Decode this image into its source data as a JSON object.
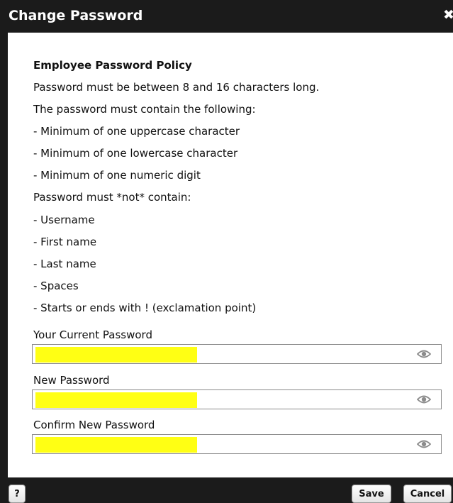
{
  "dialog": {
    "title": "Change Password",
    "close_icon_glyph": "✖"
  },
  "policy": {
    "heading": "Employee Password Policy",
    "lines": [
      "Password must be between 8 and 16 characters long.",
      "The password must contain the following:",
      "- Minimum of one uppercase character",
      "- Minimum of one lowercase character",
      "- Minimum of one numeric digit",
      "Password must *not* contain:",
      "- Username",
      "- First name",
      "- Last name",
      "- Spaces",
      "- Starts or ends with ! (exclamation point)"
    ]
  },
  "fields": {
    "current": {
      "label": "Your Current Password",
      "icon": "eye-icon"
    },
    "new": {
      "label": "New Password",
      "icon": "eye-icon"
    },
    "confirm": {
      "label": "Confirm New Password",
      "icon": "eye-icon"
    }
  },
  "footer": {
    "help_label": "?",
    "save_label": "Save",
    "cancel_label": "Cancel"
  },
  "colors": {
    "titlebar": "#1b1b1b",
    "redaction": "#ffff14",
    "eye_icon": "#8c8c8c"
  }
}
